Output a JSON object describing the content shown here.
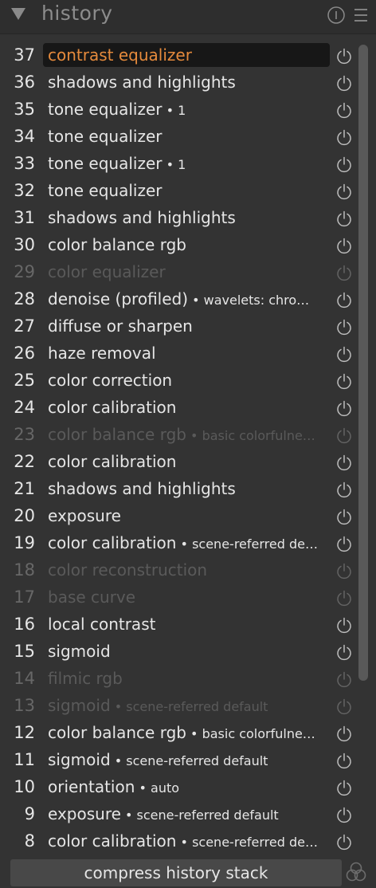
{
  "panel": {
    "title": "history",
    "compress_label": "compress history stack"
  },
  "colors": {
    "active_text": "#e58a3c",
    "normal_text": "#e6e6e6",
    "disabled_text": "#5a5a5a"
  },
  "items": [
    {
      "num": "37",
      "label": "contrast equalizer",
      "sub": "",
      "state": "active"
    },
    {
      "num": "36",
      "label": "shadows and highlights",
      "sub": "",
      "state": "normal"
    },
    {
      "num": "35",
      "label": "tone equalizer",
      "sub": "1",
      "state": "normal"
    },
    {
      "num": "34",
      "label": "tone equalizer",
      "sub": "",
      "state": "normal"
    },
    {
      "num": "33",
      "label": "tone equalizer",
      "sub": "1",
      "state": "normal"
    },
    {
      "num": "32",
      "label": "tone equalizer",
      "sub": "",
      "state": "normal"
    },
    {
      "num": "31",
      "label": "shadows and highlights",
      "sub": "",
      "state": "normal"
    },
    {
      "num": "30",
      "label": "color balance rgb",
      "sub": "",
      "state": "normal"
    },
    {
      "num": "29",
      "label": "color equalizer",
      "sub": "",
      "state": "disabled"
    },
    {
      "num": "28",
      "label": "denoise (profiled)",
      "sub": "wavelets: chro…",
      "state": "normal"
    },
    {
      "num": "27",
      "label": "diffuse or sharpen",
      "sub": "",
      "state": "normal"
    },
    {
      "num": "26",
      "label": "haze removal",
      "sub": "",
      "state": "normal"
    },
    {
      "num": "25",
      "label": "color correction",
      "sub": "",
      "state": "normal"
    },
    {
      "num": "24",
      "label": "color calibration",
      "sub": "",
      "state": "normal"
    },
    {
      "num": "23",
      "label": "color balance rgb",
      "sub": "basic colorfulne…",
      "state": "disabled"
    },
    {
      "num": "22",
      "label": "color calibration",
      "sub": "",
      "state": "normal"
    },
    {
      "num": "21",
      "label": "shadows and highlights",
      "sub": "",
      "state": "normal"
    },
    {
      "num": "20",
      "label": "exposure",
      "sub": "",
      "state": "normal"
    },
    {
      "num": "19",
      "label": "color calibration",
      "sub": "scene-referred de…",
      "state": "normal"
    },
    {
      "num": "18",
      "label": "color reconstruction",
      "sub": "",
      "state": "disabled"
    },
    {
      "num": "17",
      "label": "base curve",
      "sub": "",
      "state": "disabled"
    },
    {
      "num": "16",
      "label": "local contrast",
      "sub": "",
      "state": "normal"
    },
    {
      "num": "15",
      "label": "sigmoid",
      "sub": "",
      "state": "normal"
    },
    {
      "num": "14",
      "label": "filmic rgb",
      "sub": "",
      "state": "disabled"
    },
    {
      "num": "13",
      "label": "sigmoid",
      "sub": "scene-referred default",
      "state": "disabled"
    },
    {
      "num": "12",
      "label": "color balance rgb",
      "sub": "basic colorfulne…",
      "state": "normal"
    },
    {
      "num": "11",
      "label": "sigmoid",
      "sub": "scene-referred default",
      "state": "normal"
    },
    {
      "num": "10",
      "label": "orientation",
      "sub": "auto",
      "state": "normal"
    },
    {
      "num": "9",
      "label": "exposure",
      "sub": "scene-referred default",
      "state": "normal"
    },
    {
      "num": "8",
      "label": "color calibration",
      "sub": "scene-referred de…",
      "state": "normal"
    }
  ]
}
